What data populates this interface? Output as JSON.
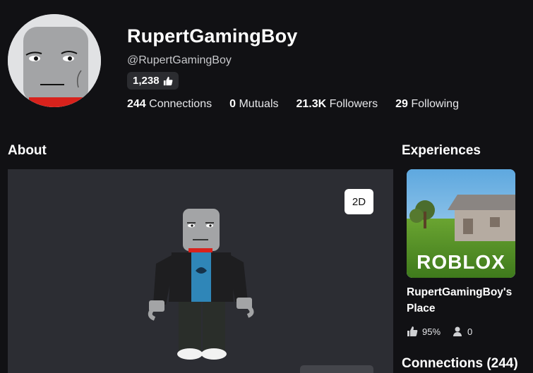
{
  "profile": {
    "display_name": "RupertGamingBoy",
    "username": "@RupertGamingBoy",
    "likes": "1,238",
    "stats": [
      {
        "value": "244",
        "label": "Connections"
      },
      {
        "value": "0",
        "label": "Mutuals"
      },
      {
        "value": "21.3K",
        "label": "Followers"
      },
      {
        "value": "29",
        "label": "Following"
      }
    ]
  },
  "about": {
    "title": "About",
    "view_toggle_label": "2D"
  },
  "experiences": {
    "title": "Experiences",
    "items": [
      {
        "name": "RupertGamingBoy's Place",
        "thumbnail_text": "ROBLOX",
        "rating": "95%",
        "players": "0"
      }
    ]
  },
  "connections": {
    "title": "Connections (244)"
  },
  "colors": {
    "background": "#111114",
    "panel": "#2c2d33",
    "pill": "#2b2c30"
  },
  "icons": [
    "thumbs-up-icon",
    "user-icon"
  ]
}
